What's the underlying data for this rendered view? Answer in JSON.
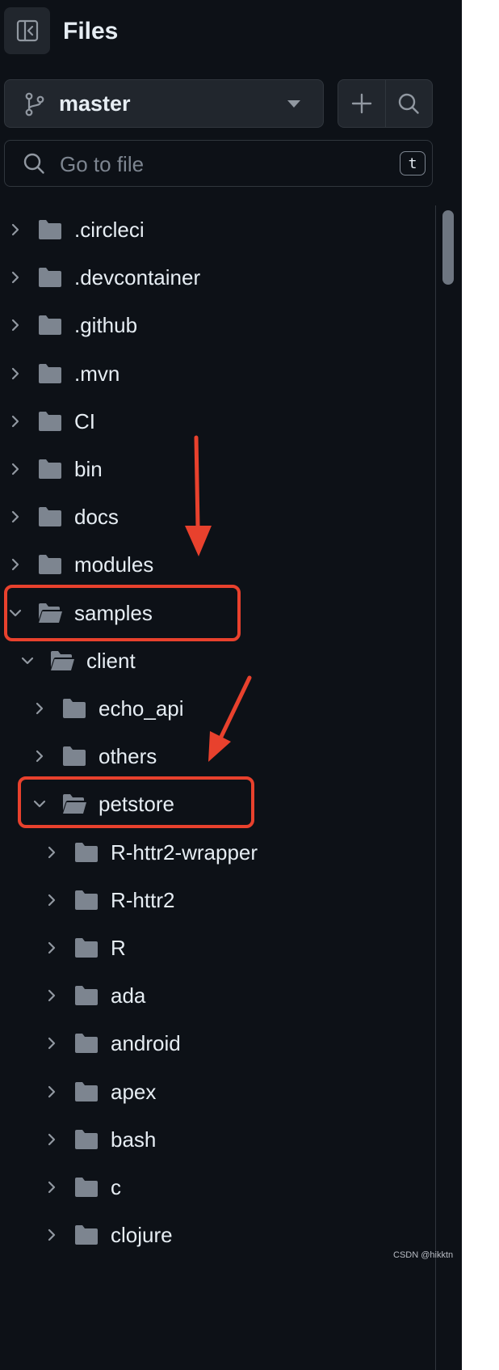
{
  "header": {
    "title": "Files",
    "toggle_icon": "sidebar-collapse-icon"
  },
  "branch": {
    "name": "master",
    "icon": "git-branch-icon"
  },
  "actions": {
    "add_icon": "plus-icon",
    "search_icon": "search-icon"
  },
  "search": {
    "placeholder": "Go to file",
    "value": "",
    "shortcut": "t"
  },
  "tree": [
    {
      "label": ".circleci",
      "depth": 0,
      "expanded": false
    },
    {
      "label": ".devcontainer",
      "depth": 0,
      "expanded": false
    },
    {
      "label": ".github",
      "depth": 0,
      "expanded": false
    },
    {
      "label": ".mvn",
      "depth": 0,
      "expanded": false
    },
    {
      "label": "CI",
      "depth": 0,
      "expanded": false
    },
    {
      "label": "bin",
      "depth": 0,
      "expanded": false
    },
    {
      "label": "docs",
      "depth": 0,
      "expanded": false
    },
    {
      "label": "modules",
      "depth": 0,
      "expanded": false
    },
    {
      "label": "samples",
      "depth": 0,
      "expanded": true
    },
    {
      "label": "client",
      "depth": 1,
      "expanded": true
    },
    {
      "label": "echo_api",
      "depth": 2,
      "expanded": false
    },
    {
      "label": "others",
      "depth": 2,
      "expanded": false
    },
    {
      "label": "petstore",
      "depth": 2,
      "expanded": true
    },
    {
      "label": "R-httr2-wrapper",
      "depth": 3,
      "expanded": false
    },
    {
      "label": "R-httr2",
      "depth": 3,
      "expanded": false
    },
    {
      "label": "R",
      "depth": 3,
      "expanded": false
    },
    {
      "label": "ada",
      "depth": 3,
      "expanded": false
    },
    {
      "label": "android",
      "depth": 3,
      "expanded": false
    },
    {
      "label": "apex",
      "depth": 3,
      "expanded": false
    },
    {
      "label": "bash",
      "depth": 3,
      "expanded": false
    },
    {
      "label": "c",
      "depth": 3,
      "expanded": false
    },
    {
      "label": "clojure",
      "depth": 3,
      "expanded": false
    }
  ],
  "annotations": {
    "highlighted": [
      "samples",
      "petstore"
    ],
    "color": "#e8412d"
  },
  "watermark": "CSDN @hikktn",
  "colors": {
    "background": "#0d1117",
    "surface": "#21262d",
    "border": "#30363d",
    "text": "#e6edf3",
    "muted": "#7d8590",
    "folder": "#7d8590"
  }
}
